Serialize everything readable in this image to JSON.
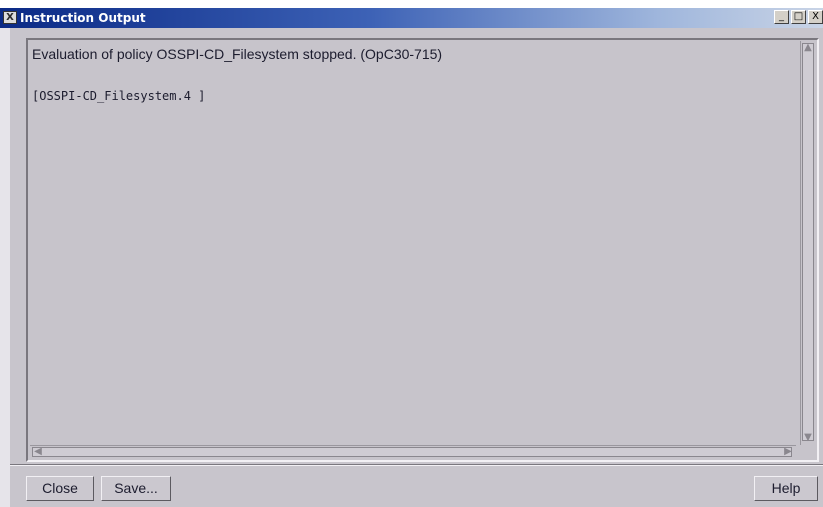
{
  "window": {
    "title": "Instruction Output",
    "icon_glyph": "X",
    "controls": {
      "minimize": "_",
      "maximize": "□",
      "close": "X"
    }
  },
  "output": {
    "lines": [
      "Evaluation of policy OSSPI-CD_Filesystem stopped. (OpC30-715)",
      "[OSSPI-CD_Filesystem.4 ]"
    ]
  },
  "scroll": {
    "up_arrow": "▲",
    "down_arrow": "▼",
    "left_arrow": "◀",
    "right_arrow": "▶"
  },
  "buttons": {
    "close": "Close",
    "save": "Save...",
    "help": "Help"
  },
  "colors": {
    "title_start": "#0b2a86",
    "title_end": "#c9d4e6",
    "window_bg": "#c8c5cc"
  }
}
